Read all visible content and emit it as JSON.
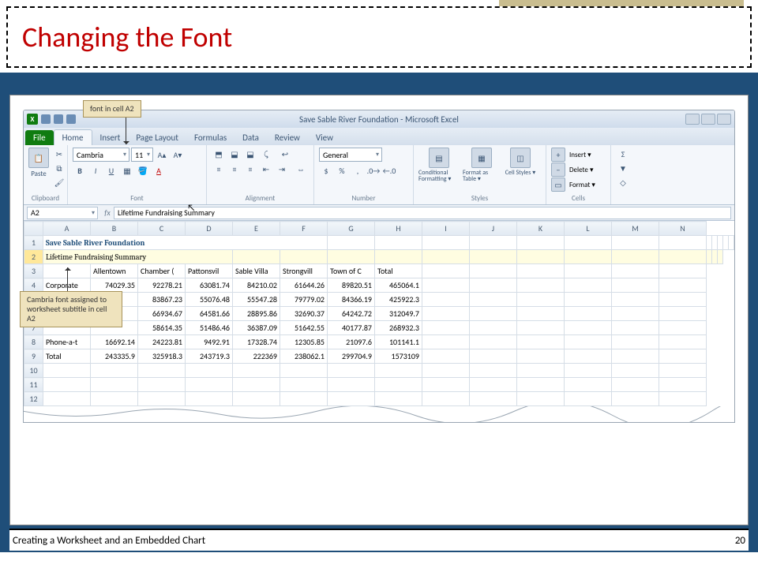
{
  "slide": {
    "title": "Changing the Font",
    "footer_left": "Creating a Worksheet and an Embedded Chart",
    "footer_right": "20"
  },
  "callouts": {
    "font_box": "font in cell A2",
    "subtitle_note": "Cambria font assigned to worksheet subtitle in cell A2"
  },
  "excel": {
    "window_title": "Save Sable River Foundation - Microsoft Excel",
    "tabs": [
      "File",
      "Home",
      "Insert",
      "Page Layout",
      "Formulas",
      "Data",
      "Review",
      "View"
    ],
    "active_tab": "Home",
    "ribbon": {
      "clipboard": {
        "label": "Clipboard",
        "paste": "Paste"
      },
      "font": {
        "label": "Font",
        "name": "Cambria",
        "size": "11"
      },
      "alignment": {
        "label": "Alignment"
      },
      "number": {
        "label": "Number",
        "format": "General"
      },
      "styles": {
        "label": "Styles",
        "cond": "Conditional Formatting ▾",
        "fat": "Format as Table ▾",
        "cell": "Cell Styles ▾"
      },
      "cells": {
        "label": "Cells",
        "insert": "Insert ▾",
        "delete": "Delete ▾",
        "format": "Format ▾"
      }
    },
    "name_box": "A2",
    "formula": "Lifetime Fundraising Summary",
    "columns": [
      "A",
      "B",
      "C",
      "D",
      "E",
      "F",
      "G",
      "H",
      "I",
      "J",
      "K",
      "L",
      "M",
      "N"
    ],
    "sheet_title": "Save Sable River Foundation",
    "sheet_subtitle": "Lifetime Fundraising Summary",
    "header_row": [
      "",
      "Allentown",
      "Chamber (",
      "Pattonsvil",
      "Sable Villa",
      "Strongvill",
      "Town of C",
      "Total"
    ],
    "rows": [
      {
        "h": "4",
        "label": "Corporate",
        "v": [
          "74029.35",
          "92278.21",
          "63081.74",
          "84210.02",
          "61644.26",
          "89820.51",
          "465064.1"
        ]
      },
      {
        "h": "5",
        "label": "",
        "v": [
          "",
          "83867.23",
          "55076.48",
          "55547.28",
          "79779.02",
          "84366.19",
          "425922.3"
        ]
      },
      {
        "h": "6",
        "label": "",
        "v": [
          "",
          "66934.67",
          "64581.66",
          "28895.86",
          "32690.37",
          "64242.72",
          "312049.7"
        ]
      },
      {
        "h": "7",
        "label": "",
        "v": [
          "",
          "58614.35",
          "51486.46",
          "36387.09",
          "51642.55",
          "40177.87",
          "268932.3"
        ]
      },
      {
        "h": "8",
        "label": "Phone-a-t",
        "v": [
          "16692.14",
          "24223.81",
          "9492.91",
          "17328.74",
          "12305.85",
          "21097.6",
          "101141.1"
        ]
      },
      {
        "h": "9",
        "label": "Total",
        "v": [
          "243335.9",
          "325918.3",
          "243719.3",
          "222369",
          "238062.1",
          "299704.9",
          "1573109"
        ]
      }
    ]
  }
}
